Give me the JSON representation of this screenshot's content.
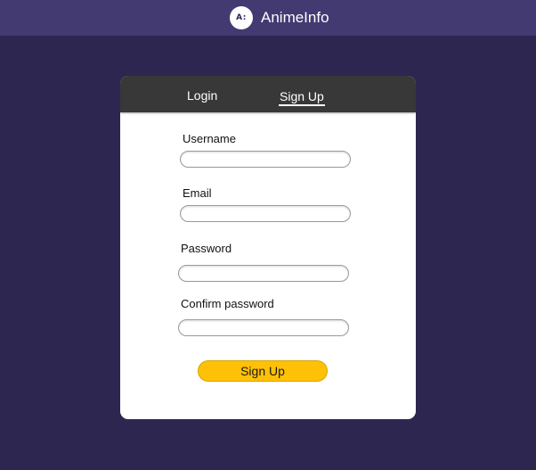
{
  "header": {
    "logo_text": "A:",
    "app_name": "AnimeInfo",
    "background_color": "#433a72"
  },
  "page": {
    "background_color": "#2c2650"
  },
  "auth_card": {
    "tabs": [
      {
        "label": "Login",
        "active": false
      },
      {
        "label": "Sign Up",
        "active": true
      }
    ],
    "fields": {
      "username": {
        "label": "Username",
        "value": ""
      },
      "email": {
        "label": "Email",
        "value": ""
      },
      "password": {
        "label": "Password",
        "value": ""
      },
      "confirm_password": {
        "label": "Confirm password",
        "value": ""
      }
    },
    "submit_label": "Sign Up",
    "submit_color": "#ffc107"
  }
}
